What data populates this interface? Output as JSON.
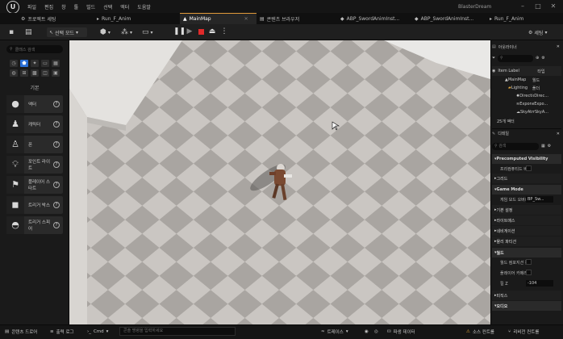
{
  "titlebar": {
    "menu": [
      "파일",
      "편집",
      "창",
      "툴",
      "빌드",
      "선택",
      "액터",
      "도움말"
    ],
    "project_name": "BlasterDream"
  },
  "tabs": [
    {
      "label": "프로젝트 세팅",
      "active": false
    },
    {
      "label": "Run_F_Anim",
      "active": false
    },
    {
      "label": "MainMap",
      "active": true
    },
    {
      "label": "콘텐츠 브라우저",
      "active": false
    },
    {
      "label": "ABP_SwordAnimInst...",
      "active": false
    },
    {
      "label": "ABP_SwordAnimInst...",
      "active": false
    },
    {
      "label": "Run_F_Anim",
      "active": false
    }
  ],
  "toolbar": {
    "mode_label": "선택 모드",
    "settings_label": "세팅"
  },
  "left_panel": {
    "search_placeholder": "클래스 검색",
    "category_title": "기본",
    "items": [
      {
        "label": "액터",
        "icon": "sphere-icon"
      },
      {
        "label": "캐릭터",
        "icon": "character-icon"
      },
      {
        "label": "폰",
        "icon": "pawn-icon"
      },
      {
        "label": "포인트 라이트",
        "icon": "point-light-icon"
      },
      {
        "label": "플레이어 스타트",
        "icon": "player-start-icon"
      },
      {
        "label": "트리거 박스",
        "icon": "cube-icon"
      },
      {
        "label": "트리거 스피어",
        "icon": "sphere-trigger-icon"
      }
    ]
  },
  "outliner": {
    "title": "아웃라이너",
    "col_label": "Item Label",
    "col_type": "타입",
    "rows": [
      {
        "label": "MainMap",
        "type": "월드"
      },
      {
        "label": "Lighting",
        "type": "폴더"
      },
      {
        "label": "Directional...",
        "type": "Direc..."
      },
      {
        "label": "ExponentialHeight...",
        "type": "Expo..."
      },
      {
        "label": "SkyAtmosphere",
        "type": "SkyA..."
      }
    ],
    "count": "25개 액터"
  },
  "details": {
    "title": "디테일",
    "search_placeholder": "검색",
    "sections": [
      {
        "header": "Precomputed Visibility",
        "props": [
          {
            "label": "프리컴퓨티드 비저빌리티",
            "type": "checkbox"
          }
        ]
      },
      {
        "header": "그리드",
        "props": []
      },
      {
        "header": "Game Mode",
        "props": [
          {
            "label": "게임 모드 오버라이드",
            "type": "select",
            "value": "BP_Sw..."
          }
        ]
      },
      {
        "header": "라이트매스",
        "props": []
      },
      {
        "header": "월드",
        "props": [
          {
            "label": "월드 컴포지션 활성화",
            "type": "checkbox"
          },
          {
            "label": "플레이어 카메라 오버라이드",
            "type": "checkbox"
          },
          {
            "label": "킬 Z",
            "type": "number",
            "value": "-104"
          }
        ]
      },
      {
        "header": "피직스",
        "props": []
      },
      {
        "header": "오디오",
        "props": []
      }
    ],
    "collapsed": [
      "기본 설정",
      "네비게이션",
      "물리 파티션"
    ]
  },
  "statusbar": {
    "content_drawer": "콘텐츠 드로어",
    "output_log": "출력 로그",
    "cmd_label": "Cmd",
    "cmd_placeholder": "콘솔 명령을 입력하세요",
    "trace": "트레이스",
    "derived_data": "파생 데이터",
    "source_control": "소스 컨트롤",
    "revision": "리비전 컨트롤"
  },
  "colors": {
    "accent_blue": "#2a6fd6",
    "active_tab_top": "#e09a3a",
    "stop_red": "#e02a2a",
    "floor_dark": "#a9a5a1",
    "floor_light": "#cac6c2"
  }
}
